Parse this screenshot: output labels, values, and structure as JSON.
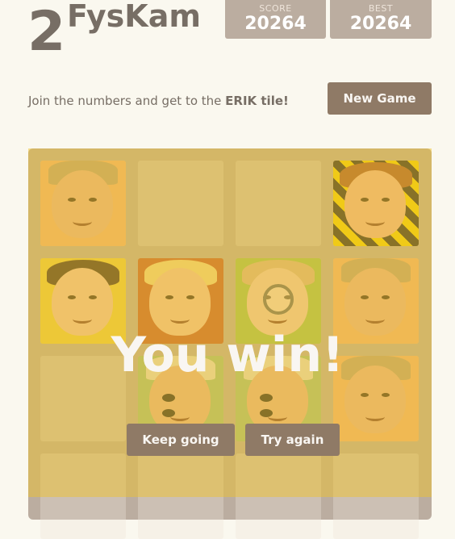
{
  "header": {
    "title_number": "2",
    "title_text": "FysKam"
  },
  "scores": {
    "score_label": "SCORE",
    "score_value": "20264",
    "best_label": "BEST",
    "best_value": "20264"
  },
  "intro": {
    "prefix": "Join the numbers and get to the ",
    "highlight": "ERIK tile!"
  },
  "buttons": {
    "new_game": "New Game",
    "keep_going": "Keep going",
    "try_again": "Try again"
  },
  "overlay": {
    "message": "You win!"
  },
  "colors": {
    "background": "#faf8ef",
    "board": "#bbada0",
    "button": "#8f7a66",
    "win_overlay": "#edc22e"
  },
  "tiles": [
    {
      "row": 0,
      "col": 0,
      "type": "face",
      "bg": "#f2b179",
      "hair": "#b99e7a",
      "skin": "#e8b08e",
      "accessory": "hat"
    },
    {
      "row": 0,
      "col": 3,
      "type": "face",
      "bg": "stripes",
      "hair": "#a0522d",
      "skin": "#f0b594",
      "accessory": "none"
    },
    {
      "row": 1,
      "col": 0,
      "type": "face",
      "bg": "#edcf40",
      "hair": "#3b2b22",
      "skin": "#f2c3a5",
      "accessory": "none"
    },
    {
      "row": 1,
      "col": 1,
      "type": "face",
      "bg": "#c0562f",
      "hair": "#f1d78a",
      "skin": "#f3c2a0",
      "accessory": "none"
    },
    {
      "row": 1,
      "col": 2,
      "type": "face",
      "bg": "#9cc254",
      "hair": "#d9b48a",
      "skin": "#f0cbb0",
      "accessory": "magnifier"
    },
    {
      "row": 1,
      "col": 3,
      "type": "face",
      "bg": "#f2b179",
      "hair": "#b99e7a",
      "skin": "#e8b08e",
      "accessory": "hat"
    },
    {
      "row": 2,
      "col": 1,
      "type": "face",
      "bg": "#9fc080",
      "hair": "#e7dfc8",
      "skin": "#e6b38e",
      "accessory": "sunglasses"
    },
    {
      "row": 2,
      "col": 2,
      "type": "face",
      "bg": "#9fc080",
      "hair": "#e7dfc8",
      "skin": "#e6b38e",
      "accessory": "sunglasses"
    },
    {
      "row": 2,
      "col": 3,
      "type": "face",
      "bg": "#f2b179",
      "hair": "#b99e7a",
      "skin": "#e8b08e",
      "accessory": "hat"
    }
  ]
}
